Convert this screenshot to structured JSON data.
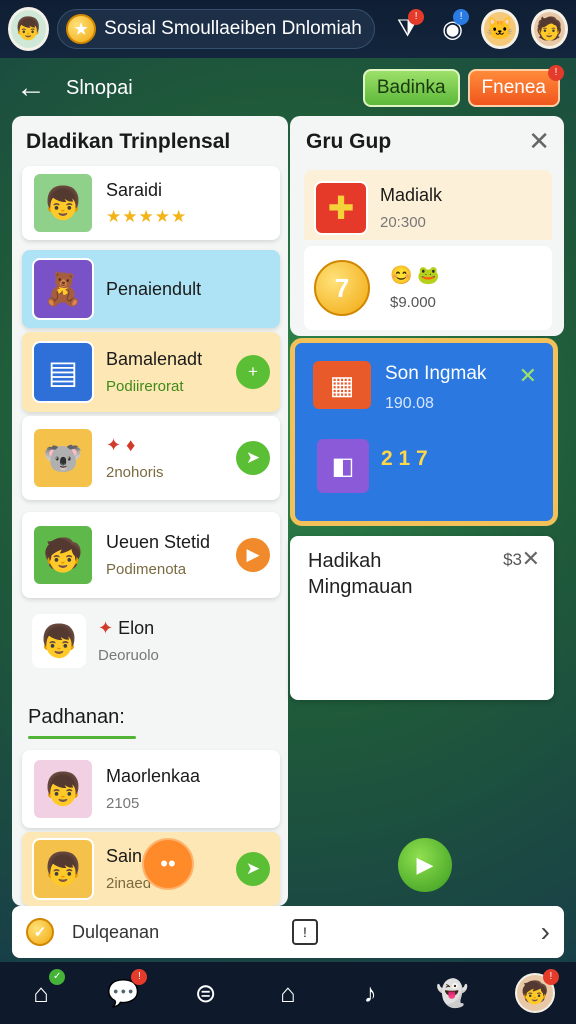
{
  "topbar": {
    "title": "Sosial Smoullaeiben Dnlomiah",
    "badge_1": "!",
    "badge_2": "!"
  },
  "subheader": {
    "title": "Slnopai",
    "btn_green": "Badinka",
    "btn_orange": "Fnenea"
  },
  "left_panel": {
    "title": "Dladikan Trinplensal",
    "items": [
      {
        "title": "Saraidi",
        "stars": "★★★★★"
      },
      {
        "title": "Penaiendult"
      },
      {
        "title": "Bamalenadt",
        "sub": "Podiirerorat"
      },
      {
        "title": "",
        "sub": "2nohoris"
      },
      {
        "title": "Ueuen Stetid",
        "sub": "Podimenota"
      },
      {
        "title": "Elon",
        "sub": "Deoruolo"
      }
    ],
    "section_heading": "Padhanan:",
    "section_items": [
      {
        "title": "Maorlenkaa",
        "sub": "2105"
      },
      {
        "title": "Sain",
        "sub": "2inaed"
      }
    ]
  },
  "right_panel": {
    "title": "Gru Gup",
    "item_1": {
      "title": "Madialk",
      "value": "20:300"
    },
    "item_2": {
      "value": "$9.000"
    }
  },
  "highlight": {
    "title": "Son Ingmak",
    "value": "190.08",
    "count": "2 1 7"
  },
  "week_card": {
    "title": "Hadikah Mingmauan",
    "close_label": "$3"
  },
  "bottom_strip": {
    "label": "Dulqeanan"
  },
  "colors": {
    "accent_green": "#52b437",
    "accent_orange": "#f0561d",
    "highlight_blue": "#2a78e0",
    "highlight_border": "#f2c15a"
  }
}
